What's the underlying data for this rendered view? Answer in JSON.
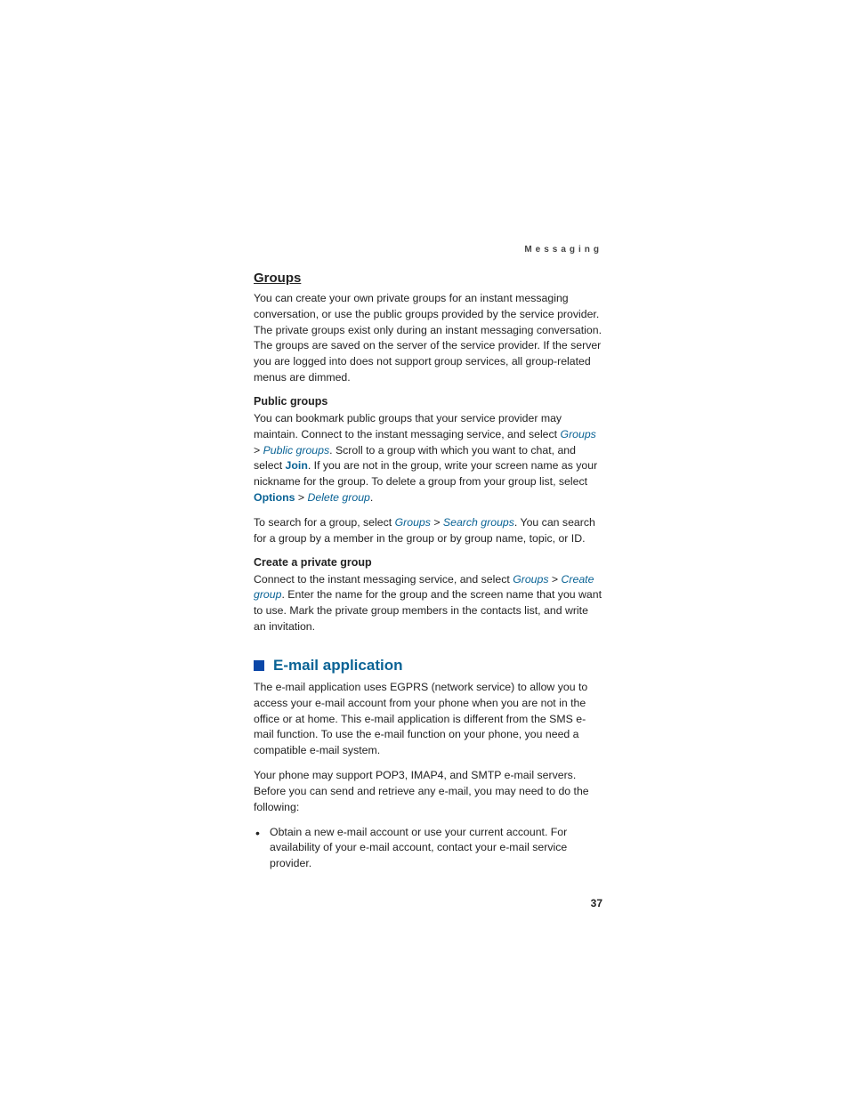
{
  "header": {
    "running": "Messaging"
  },
  "groups": {
    "title": "Groups",
    "intro": "You can create your own private groups for an instant messaging conversation, or use the public groups provided by the service provider. The private groups exist only during an instant messaging conversation. The groups are saved on the server of the service provider. If the server you are logged into does not support group services, all group-related menus are dimmed."
  },
  "public_groups": {
    "heading": "Public groups",
    "p1_a": "You can bookmark public groups that your service provider may maintain. Connect to the instant messaging service, and select ",
    "link_groups": "Groups",
    "sep": " > ",
    "link_public_groups": "Public groups",
    "p1_b": ". Scroll to a group with which you want to chat, and select ",
    "bold_join": "Join",
    "p1_c": ". If you are not in the group, write your screen name as your nickname for the group. To delete a group from your group list, select ",
    "bold_options": "Options",
    "link_delete_group": "Delete group",
    "p1_d": ".",
    "p2_a": "To search for a group, select ",
    "link_search_groups": "Search groups",
    "p2_b": ". You can search for a group by a member in the group or by group name, topic, or ID."
  },
  "create_private": {
    "heading": "Create a private group",
    "p_a": "Connect to the instant messaging service, and select ",
    "link_groups": "Groups",
    "sep": " > ",
    "link_create_group": "Create group",
    "p_b": ". Enter the name for the group and the screen name that you want to use. Mark the private group members in the contacts list, and write an invitation."
  },
  "email": {
    "title": "E-mail application",
    "p1": "The e-mail application uses EGPRS (network service) to allow you to access your e-mail account from your phone when you are not in the office or at home. This e-mail application is different from the SMS e-mail function. To use the e-mail function on your phone, you need a compatible e-mail system.",
    "p2": "Your phone may support POP3, IMAP4, and SMTP e-mail servers. Before you can send and retrieve any e-mail, you may need to do the following:",
    "bullet1": "Obtain a new e-mail account or use your current account. For availability of your e-mail account, contact your e-mail service provider."
  },
  "page_number": "37"
}
